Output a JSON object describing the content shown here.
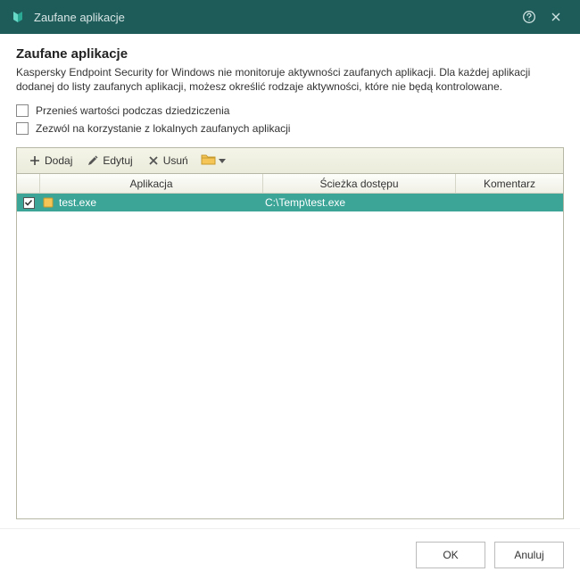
{
  "titlebar": {
    "title": "Zaufane aplikacje"
  },
  "heading": "Zaufane aplikacje",
  "description": "Kaspersky Endpoint Security for Windows nie monitoruje aktywności zaufanych aplikacji. Dla każdej aplikacji dodanej do listy zaufanych aplikacji, możesz określić rodzaje aktywności, które nie będą kontrolowane.",
  "checkboxes": {
    "inherit": "Przenieś wartości podczas dziedziczenia",
    "allow_local": "Zezwól na korzystanie z lokalnych zaufanych aplikacji"
  },
  "toolbar": {
    "add": "Dodaj",
    "edit": "Edytuj",
    "remove": "Usuń"
  },
  "columns": {
    "app": "Aplikacja",
    "path": "Ścieżka dostępu",
    "comment": "Komentarz"
  },
  "rows": [
    {
      "checked": true,
      "app": "test.exe",
      "path": "C:\\Temp\\test.exe",
      "comment": ""
    }
  ],
  "buttons": {
    "ok": "OK",
    "cancel": "Anuluj"
  }
}
